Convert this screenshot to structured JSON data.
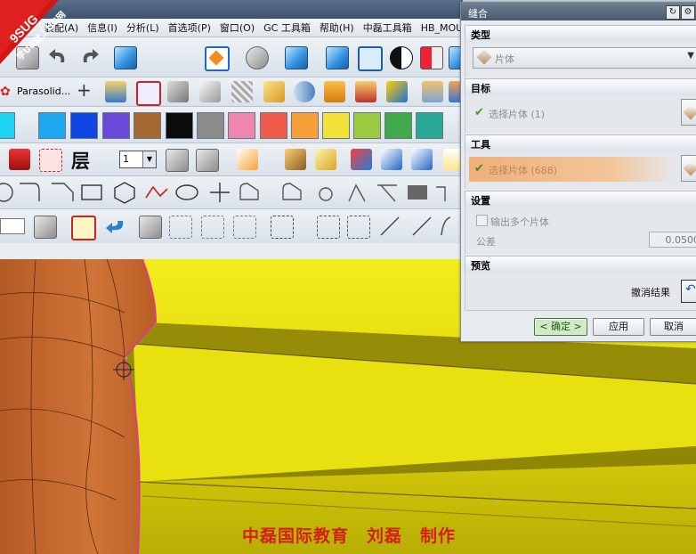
{
  "logo": {
    "text_top": "9SUG",
    "text_bottom": "学UG就上UG网"
  },
  "menubar": {
    "items": [
      "装配(A)",
      "信息(I)",
      "分析(L)",
      "首选项(P)",
      "窗口(O)",
      "GC 工具箱",
      "帮助(H)",
      "中磊工具箱",
      "HB_MOULD"
    ]
  },
  "toolbar": {
    "parasolid_label": "Parasolid...",
    "layer_label": "层",
    "layer_value": "1"
  },
  "palette": [
    "#1fd3f0",
    "#1fa7ee",
    "#1046e6",
    "#6a49d8",
    "#a4672f",
    "#0b0b0b",
    "#8b8b8b",
    "#ef86ad",
    "#f05a4a",
    "#f7a03a",
    "#f2e23a",
    "#9bc93f",
    "#3fa94b",
    "#2aa896"
  ],
  "dialog": {
    "title": "缝合",
    "type_header": "类型",
    "type_value": "片体",
    "target_header": "目标",
    "target_select": "选择片体 (1)",
    "tool_header": "工具",
    "tool_select": "选择片体 (688)",
    "settings_header": "设置",
    "output_multiple": "输出多个片体",
    "tolerance_label": "公差",
    "tolerance_value": "0.0500",
    "preview_header": "预览",
    "undo_result": "撤消结果",
    "ok_label": "< 确定 >",
    "apply_label": "应用",
    "cancel_label": "取消"
  },
  "credit": "中磊国际教育　刘磊　制作",
  "colors": {
    "tool_highlight": "#f0b07a",
    "viewport_yellow": "#e3da0c",
    "model_orange": "#c0652a",
    "credit_red": "#d2201a"
  }
}
